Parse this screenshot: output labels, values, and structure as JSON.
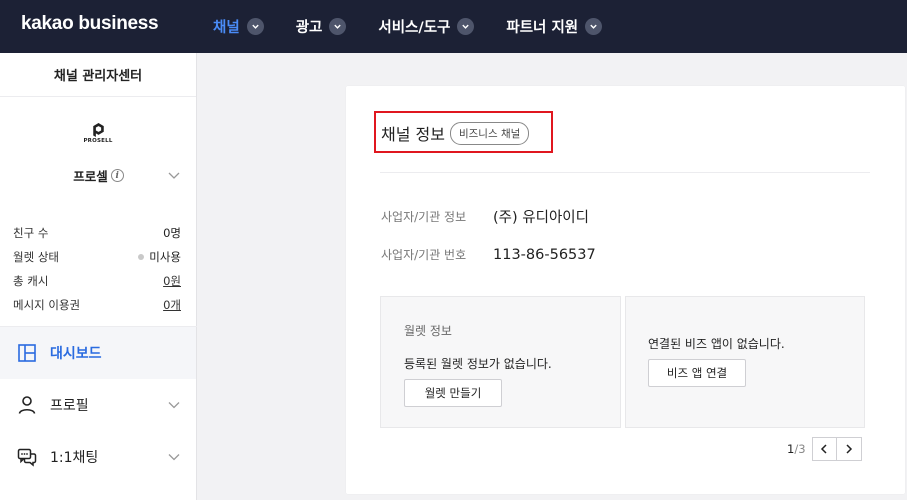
{
  "header": {
    "logo": "kakao business",
    "nav": [
      {
        "label": "채널",
        "active": true
      },
      {
        "label": "광고",
        "active": false
      },
      {
        "label": "서비스/도구",
        "active": false
      },
      {
        "label": "파트너 지원",
        "active": false
      }
    ]
  },
  "sidebar": {
    "title": "채널 관리자센터",
    "profile": {
      "logo_text": "PROSELL",
      "name": "프로셀"
    },
    "stats": [
      {
        "label": "친구 수",
        "value": "0명"
      },
      {
        "label": "월렛 상태",
        "value": "미사용"
      },
      {
        "label": "총 캐시",
        "value": "0원"
      },
      {
        "label": "메시지 이용권",
        "value": "0개"
      }
    ],
    "menu": [
      {
        "label": "대시보드",
        "icon": "dashboard-icon",
        "active": true
      },
      {
        "label": "프로필",
        "icon": "user-icon",
        "active": false
      },
      {
        "label": "1:1채팅",
        "icon": "chat-icon",
        "active": false
      }
    ]
  },
  "card": {
    "title": "채널 정보",
    "badge": "비즈니스 채널",
    "fields": [
      {
        "label": "사업자/기관 정보",
        "value": "(주) 유디아이디"
      },
      {
        "label": "사업자/기관 번호",
        "value": "113-86-56537"
      }
    ],
    "wallet": {
      "title": "월렛 정보",
      "message": "등록된 월렛 정보가 없습니다.",
      "button": "월렛 만들기"
    },
    "bizapp": {
      "message": "연결된 비즈 앱이 없습니다.",
      "button": "비즈 앱 연결"
    },
    "pager": {
      "current": "1",
      "total": "/3"
    }
  },
  "colors": {
    "topbar": "#1c2135",
    "accent": "#4a8cf7",
    "highlight": "#e0161f"
  }
}
